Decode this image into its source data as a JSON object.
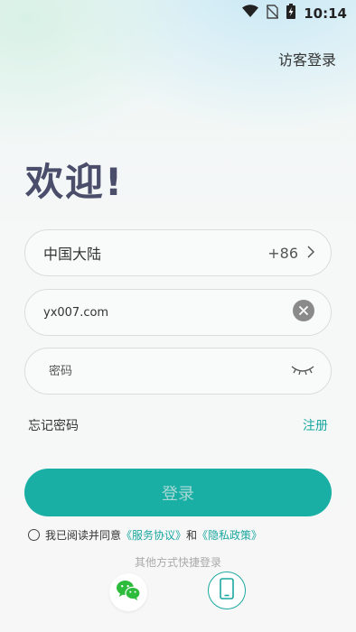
{
  "status_bar": {
    "time": "10:14",
    "icons": [
      "wifi-icon",
      "no-sim-icon",
      "battery-charging-icon"
    ]
  },
  "header": {
    "guest_login_label": "访客登录"
  },
  "welcome_title": "欢迎!",
  "region": {
    "name": "中国大陆",
    "code": "+86"
  },
  "account": {
    "value": "yx007.com"
  },
  "password": {
    "placeholder": "密码"
  },
  "links": {
    "forgot_password": "忘记密码",
    "register": "注册"
  },
  "login_button_label": "登录",
  "agreement": {
    "prefix": "我已阅读并同意",
    "service_agreement": "《服务协议》",
    "conjunction": "和",
    "privacy_policy": "《隐私政策》"
  },
  "other_login": {
    "label": "其他方式快捷登录",
    "methods": [
      "wechat-icon",
      "phone-icon"
    ]
  },
  "colors": {
    "accent": "#1aafa5",
    "title": "#4a4e6a"
  }
}
